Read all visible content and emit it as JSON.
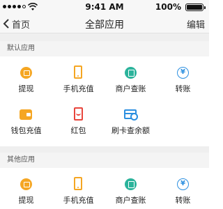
{
  "status_bar": {
    "time": "9:41 AM",
    "battery": "100%"
  },
  "nav": {
    "back_label": "首页",
    "title": "全部应用",
    "edit_label": "编辑"
  },
  "default_section": {
    "title": "默认应用",
    "apps": [
      {
        "label": "提现",
        "icon": "withdraw-icon"
      },
      {
        "label": "手机充值",
        "icon": "phone-recharge-icon"
      },
      {
        "label": "商户查账",
        "icon": "merchant-ledger-icon"
      },
      {
        "label": "转账",
        "icon": "transfer-icon"
      },
      {
        "label": "钱包充值",
        "icon": "wallet-recharge-icon"
      },
      {
        "label": "红包",
        "icon": "red-envelope-icon"
      },
      {
        "label": "刷卡查余额",
        "icon": "card-balance-icon"
      }
    ]
  },
  "other_section": {
    "title": "其他应用",
    "apps": [
      {
        "label": "提现",
        "icon": "withdraw-icon"
      },
      {
        "label": "手机充值",
        "icon": "phone-recharge-icon"
      },
      {
        "label": "商户查账",
        "icon": "merchant-ledger-icon"
      },
      {
        "label": "转账",
        "icon": "transfer-icon"
      }
    ]
  },
  "colors": {
    "orange": "#f5a623",
    "teal": "#2bb39b",
    "blue": "#2b8fe0",
    "red": "#e8453c"
  }
}
